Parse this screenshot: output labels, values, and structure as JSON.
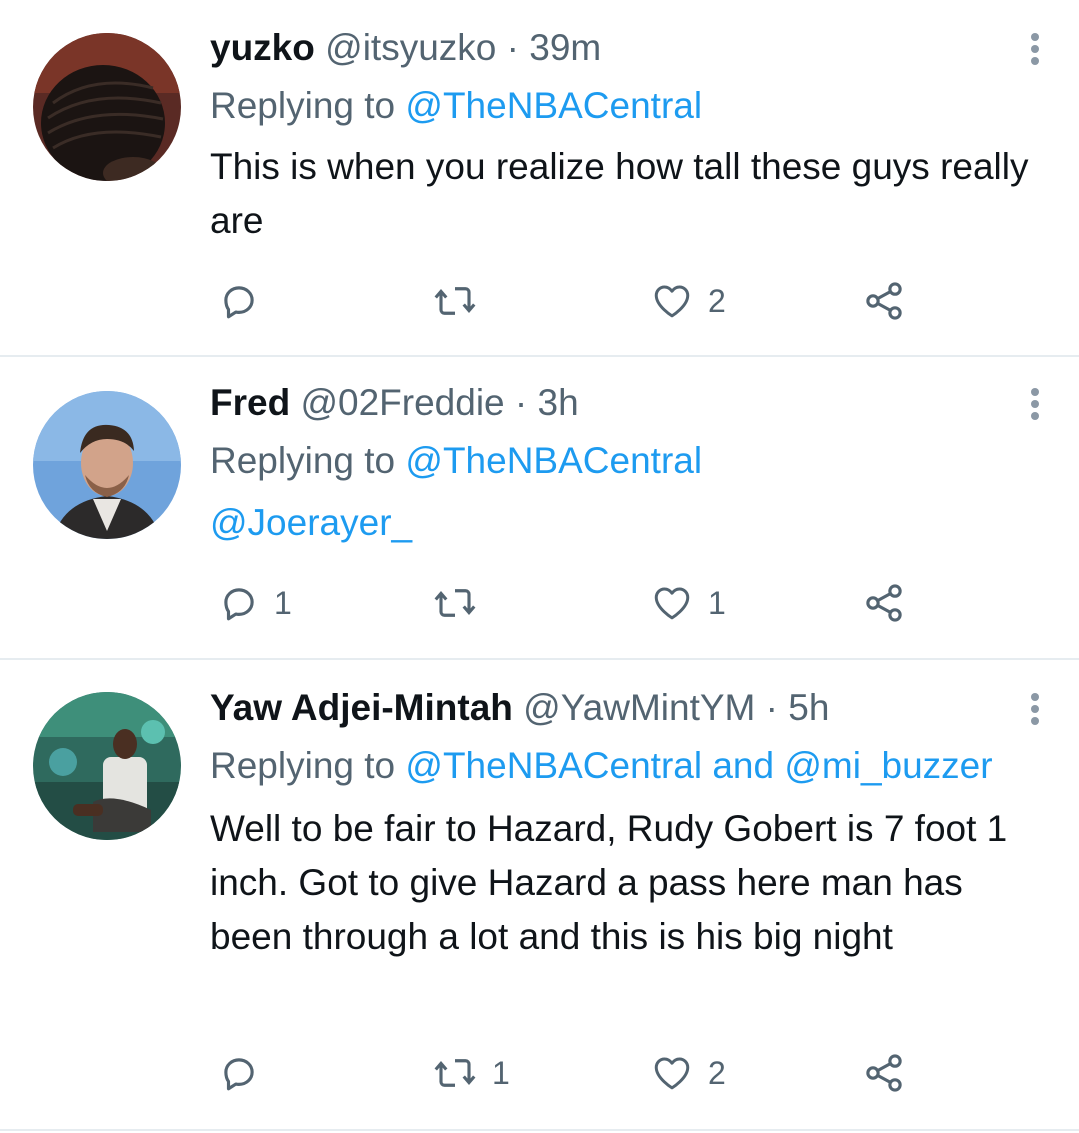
{
  "tweets": [
    {
      "name": "yuzko",
      "handle": "@itsyuzko",
      "separator": "·",
      "time": "39m",
      "replying_prefix": "Replying to",
      "replying_to": "@TheNBACentral",
      "text": "This is when you realize how tall these guys really are",
      "mention": "",
      "reply_count": "",
      "retweet_count": "",
      "like_count": "2",
      "avatar_icon": "avatar-braids"
    },
    {
      "name": "Fred",
      "handle": "@02Freddie",
      "separator": "·",
      "time": "3h",
      "replying_prefix": "Replying to",
      "replying_to": "@TheNBACentral",
      "text": "",
      "mention": "@Joerayer_",
      "reply_count": "1",
      "retweet_count": "",
      "like_count": "1",
      "avatar_icon": "avatar-man-blue-sky"
    },
    {
      "name": "Yaw Adjei-Mintah",
      "handle": "@YawMintYM",
      "separator": "·",
      "time": "5h",
      "replying_prefix": "Replying to",
      "replying_to": "@TheNBACentral and @mi_buzzer",
      "text": "Well to be fair to Hazard, Rudy Gobert is 7 foot 1 inch. Got to give Hazard a pass here man has been through a lot and this is his big night",
      "mention": "",
      "reply_count": "",
      "retweet_count": "1",
      "like_count": "2",
      "avatar_icon": "avatar-man-studio"
    }
  ],
  "icons": {
    "reply": "reply-icon",
    "retweet": "retweet-icon",
    "like": "like-icon",
    "share": "share-icon",
    "more": "more-vertical-icon"
  },
  "colors": {
    "text": "#0f1419",
    "secondary": "#536471",
    "link": "#1d9bf0",
    "divider": "#e6ecf0"
  }
}
